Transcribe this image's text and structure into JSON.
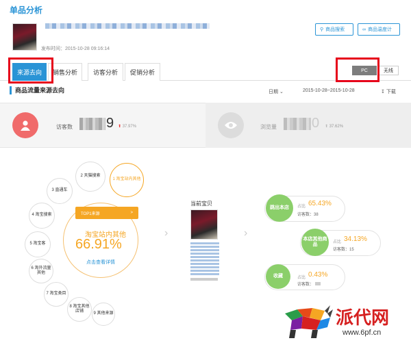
{
  "page": {
    "title": "单品分析"
  },
  "product": {
    "publish_time": "发布时间：2015-10-28 09:16:14"
  },
  "header_buttons": {
    "search": "商品搜索",
    "monitor": "商品温度计"
  },
  "tabs": [
    "来源去向",
    "销售分析",
    "访客分析",
    "促销分析"
  ],
  "device": {
    "pc": "PC",
    "wireless": "无线"
  },
  "section": {
    "title": "商品流量来源去向",
    "date_label": "日期",
    "date_range": "2015-10-28~2015-10-28",
    "download": "下载"
  },
  "stats": {
    "visitors": {
      "label": "访客数",
      "value_tail": "9",
      "trend": "37.97%"
    },
    "pageviews": {
      "label": "浏览量",
      "value_tail": "0",
      "trend": "37.62%"
    }
  },
  "sources": [
    {
      "no": "1",
      "name": "淘宝站内其他"
    },
    {
      "no": "2",
      "name": "天猫搜索"
    },
    {
      "no": "3",
      "name": "直通车"
    },
    {
      "no": "4",
      "name": "淘宝搜索"
    },
    {
      "no": "5",
      "name": "淘宝客"
    },
    {
      "no": "6",
      "name": "淘外流量其他"
    },
    {
      "no": "7",
      "name": "淘宝类目"
    },
    {
      "no": "8",
      "name": "淘宝其他店铺"
    },
    {
      "no": "9",
      "name": "其他来源"
    }
  ],
  "top_source": {
    "badge": "TOP1来源",
    "name": "淘宝站内其他",
    "percent": "66.91%",
    "link": "点击查看详情"
  },
  "current": {
    "label": "当前宝贝"
  },
  "destinations": [
    {
      "name": "跳出本店",
      "ratio_label": "占比",
      "ratio": "65.43%",
      "visits_label": "访客数",
      "visits": "38"
    },
    {
      "name": "本店其他商品",
      "ratio_label": "占比",
      "ratio": "34.13%",
      "visits_label": "访客数",
      "visits": "15"
    },
    {
      "name": "收藏",
      "ratio_label": "占比",
      "ratio": "0.43%",
      "visits_label": "访客数",
      "visits": ""
    }
  ],
  "watermark": {
    "text": "派代网",
    "url": "www.6pf.cn"
  },
  "colors": {
    "brand": "#2a94d6",
    "accent": "#f5a623",
    "green": "#8bcf6a",
    "red_box": "#e6001a",
    "visitor_icon": "#f06b6b"
  }
}
